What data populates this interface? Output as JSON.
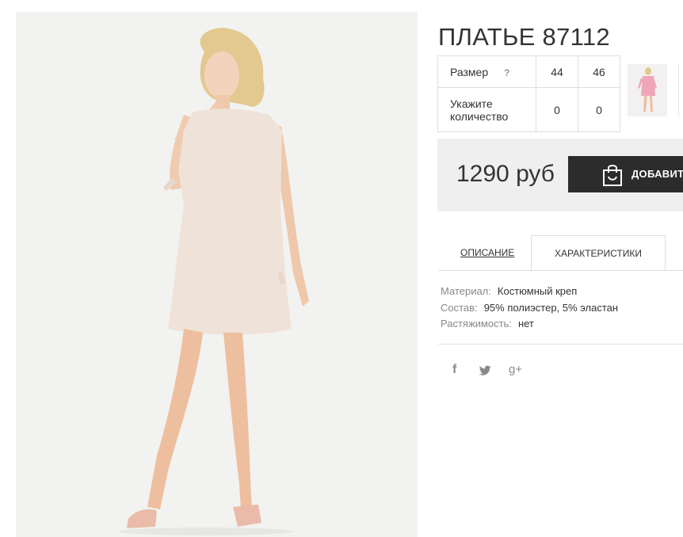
{
  "product": {
    "title": "ПЛАТЬЕ 87112",
    "photo_icon": "woman-in-beige-dress-photo"
  },
  "sizes": {
    "size_label": "Размер",
    "help": "?",
    "quantity_label_1": "Укажите",
    "quantity_label_2": "количество",
    "options": [
      {
        "size": "44",
        "qty": "0"
      },
      {
        "size": "46",
        "qty": "0"
      }
    ]
  },
  "thumbnail": {
    "icon": "pink-dress-thumbnail"
  },
  "purchase": {
    "price": "1290 руб",
    "add_label": "ДОБАВИТЬ"
  },
  "tabs": {
    "description": "ОПИСАНИЕ",
    "characteristics": "ХАРАКТЕРИСТИКИ"
  },
  "specs": [
    {
      "key": "Материал:",
      "value": "Костюмный креп"
    },
    {
      "key": "Состав:",
      "value": "95% полиэстер, 5% эластан"
    },
    {
      "key": "Растяжимость:",
      "value": "нет"
    }
  ],
  "share": {
    "facebook": "f",
    "twitter_icon": "twitter-icon",
    "google": "g+"
  },
  "colors": {
    "button_bg": "#2c2c2c",
    "price_bg": "#efefef",
    "dress": "#efe2d8",
    "thumb_dress": "#f0a6b8"
  }
}
